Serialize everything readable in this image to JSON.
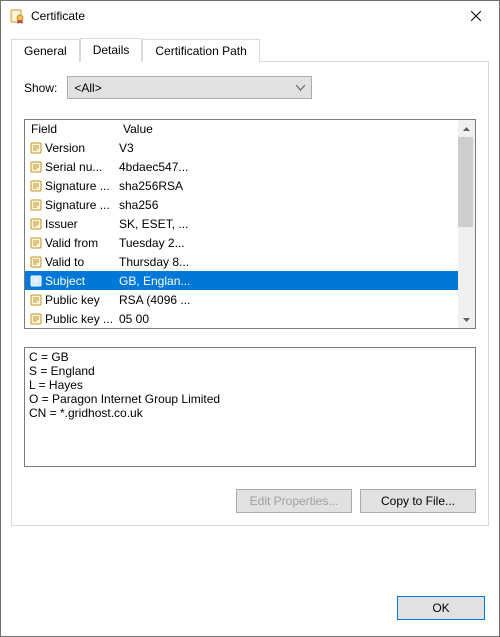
{
  "window": {
    "title": "Certificate"
  },
  "tabs": {
    "general": "General",
    "details": "Details",
    "path": "Certification Path"
  },
  "show": {
    "label": "Show:",
    "value": "<All>"
  },
  "list": {
    "headers": {
      "field": "Field",
      "value": "Value"
    },
    "rows": [
      {
        "field": "Version",
        "value": "V3",
        "selected": false
      },
      {
        "field": "Serial nu...",
        "value": "4bdaec547...",
        "selected": false
      },
      {
        "field": "Signature ...",
        "value": "sha256RSA",
        "selected": false
      },
      {
        "field": "Signature ...",
        "value": "sha256",
        "selected": false
      },
      {
        "field": "Issuer",
        "value": "SK, ESET, ...",
        "selected": false
      },
      {
        "field": "Valid from",
        "value": "Tuesday 2...",
        "selected": false
      },
      {
        "field": "Valid to",
        "value": "Thursday 8...",
        "selected": false
      },
      {
        "field": "Subject",
        "value": "GB, Englan...",
        "selected": true
      },
      {
        "field": "Public key",
        "value": "RSA (4096 ...",
        "selected": false
      },
      {
        "field": "Public key ...",
        "value": "05 00",
        "selected": false
      }
    ]
  },
  "detail_text": "C = GB\nS = England\nL = Hayes\nO = Paragon Internet Group Limited\nCN = *.gridhost.co.uk",
  "buttons": {
    "edit": "Edit Properties...",
    "copy": "Copy to File...",
    "ok": "OK"
  }
}
